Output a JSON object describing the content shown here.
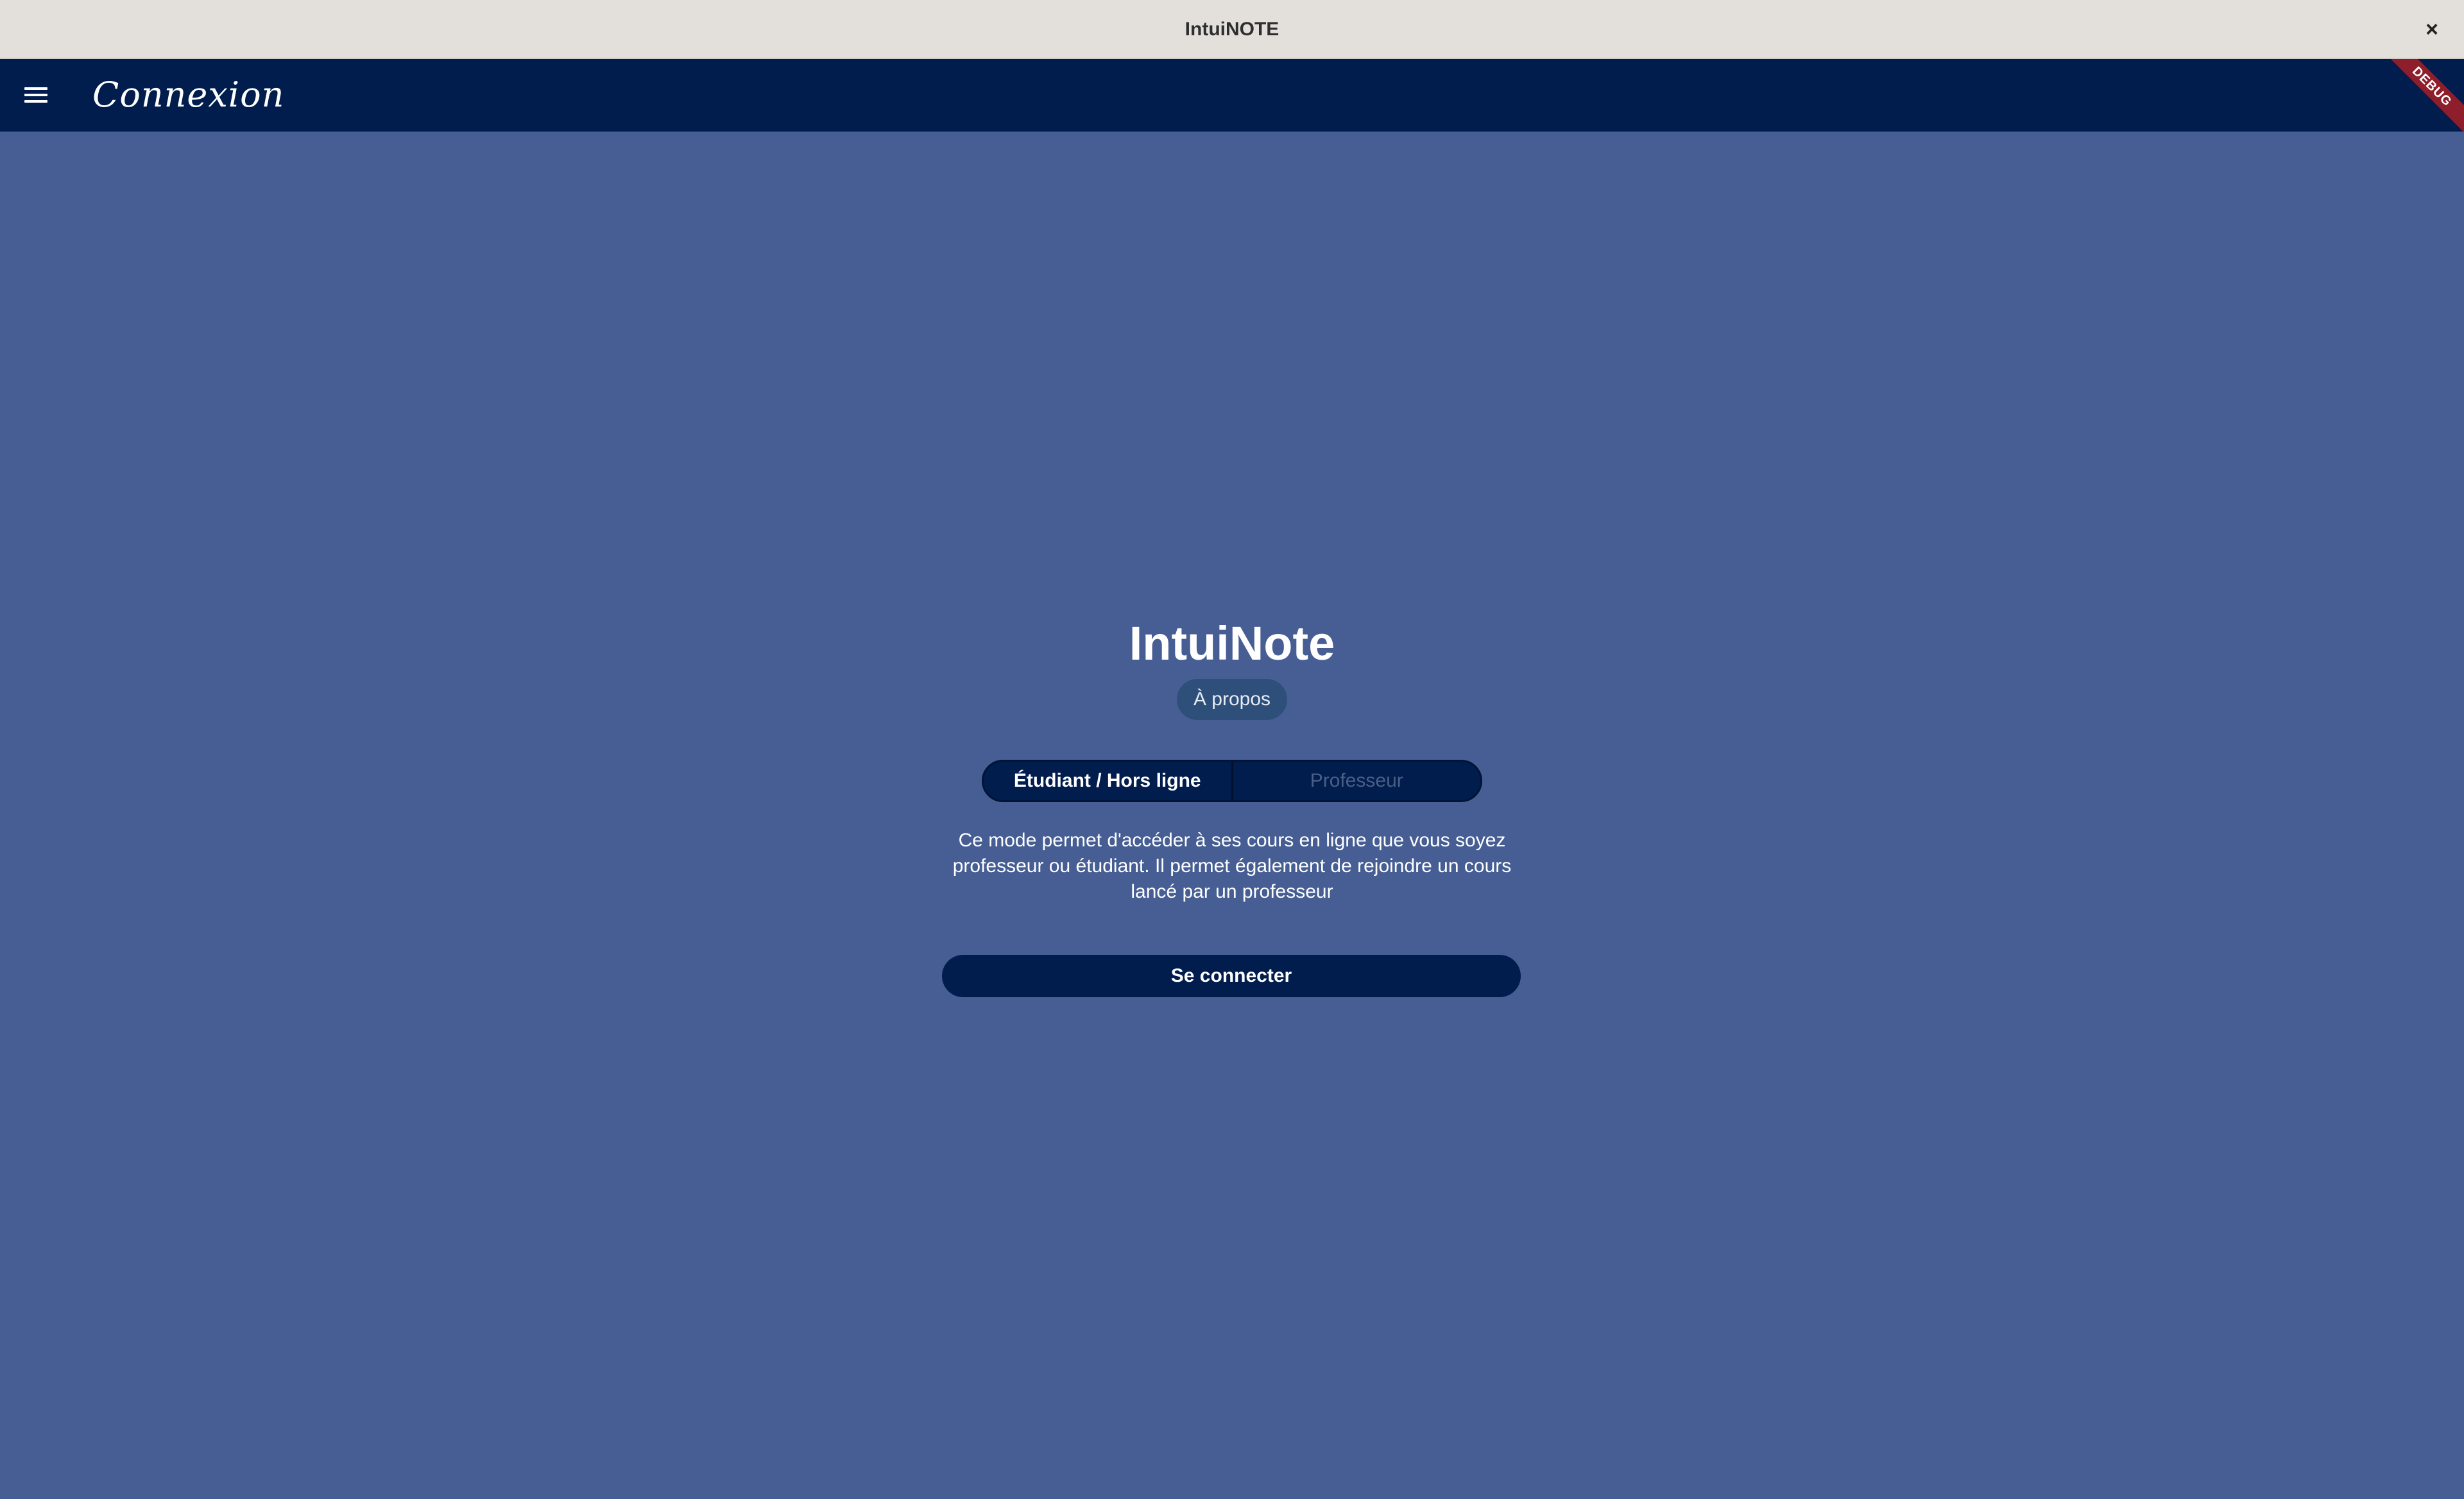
{
  "window": {
    "title": "IntuiNOTE",
    "close_glyph": "×"
  },
  "appbar": {
    "menu_icon": "hamburger-menu-icon",
    "title": "Connexion",
    "debug_banner": "DEBUG"
  },
  "main": {
    "app_name": "IntuiNote",
    "about_label": "À propos",
    "mode_selector": {
      "options": [
        {
          "label": "Étudiant / Hors ligne",
          "selected": true
        },
        {
          "label": "Professeur",
          "selected": false
        }
      ]
    },
    "description": "Ce mode permet d'accéder à ses cours en ligne que vous soyez professeur ou étudiant. Il permet également de rejoindre un cours lancé par un professeur",
    "connect_label": "Se connecter"
  },
  "colors": {
    "background": "#465e93",
    "appbar": "#001d4d",
    "titlebar": "#e3e0dc",
    "debug_banner": "#8e1e2b"
  }
}
